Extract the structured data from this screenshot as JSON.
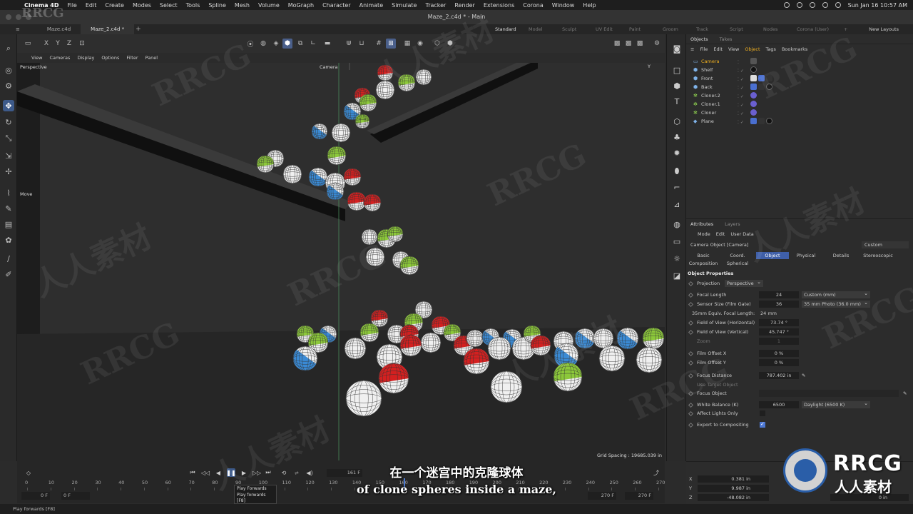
{
  "menubar": {
    "app_name": "Cinema 4D",
    "items": [
      "File",
      "Edit",
      "Create",
      "Modes",
      "Select",
      "Tools",
      "Spline",
      "Mesh",
      "Volume",
      "MoGraph",
      "Character",
      "Animate",
      "Simulate",
      "Tracker",
      "Render",
      "Extensions",
      "Corona",
      "Window",
      "Help"
    ],
    "clock": "Sun Jan 16  10:57 AM"
  },
  "window": {
    "title": "Maze_2.c4d * - Main"
  },
  "doc_tabs": [
    "Maze.c4d",
    "Maze_2.c4d *"
  ],
  "layout_tabs": [
    "Standard",
    "Model",
    "Sculpt",
    "UV Edit",
    "Paint",
    "Groom",
    "Track",
    "Script",
    "Nodes",
    "Corona (User)"
  ],
  "new_layouts": "New Layouts",
  "viewport": {
    "menu": [
      "View",
      "Cameras",
      "Display",
      "Options",
      "Filter",
      "Panel"
    ],
    "axis_buttons": [
      "X",
      "Y",
      "Z"
    ],
    "label_view": "Perspective",
    "label_camera": "Camera",
    "move_label": "Move",
    "grid_spacing": "Grid Spacing : 19685.039 in",
    "axis_y": "Y",
    "colors": {
      "red": "#d42020",
      "green": "#8cc83a",
      "blue": "#3a8ad4",
      "white": "#f0f0f0"
    }
  },
  "timeline": {
    "current_frame": "161 F",
    "ruler_ticks": [
      "0",
      "10",
      "20",
      "30",
      "40",
      "50",
      "60",
      "70",
      "80",
      "90",
      "100",
      "110",
      "120",
      "130",
      "140",
      "150",
      "160",
      "170",
      "180",
      "190",
      "200",
      "210",
      "220",
      "230",
      "240",
      "250",
      "260",
      "270"
    ],
    "start_a": "0 F",
    "start_b": "0 F",
    "end_a": "270 F",
    "end_b": "270 F"
  },
  "tooltip": {
    "title": "Play Forwards",
    "desc": "Play forwards",
    "shortcut": "[F8]"
  },
  "status": "Play forwards [F8]",
  "object_manager": {
    "tabs": [
      "Objects",
      "Takes"
    ],
    "menu": [
      "File",
      "Edit",
      "View",
      "Object",
      "Tags",
      "Bookmarks"
    ],
    "objects": [
      {
        "name": "Camera"
      },
      {
        "name": "Shelf"
      },
      {
        "name": "Front"
      },
      {
        "name": "Back"
      },
      {
        "name": "Cloner.2"
      },
      {
        "name": "Cloner.1"
      },
      {
        "name": "Cloner"
      },
      {
        "name": "Plane"
      }
    ]
  },
  "attributes": {
    "tabs": [
      "Attributes",
      "Layers"
    ],
    "menu": [
      "Mode",
      "Edit",
      "User Data"
    ],
    "object_label": "Camera Object [Camera]",
    "custom_dropdown": "Custom",
    "property_tabs": [
      "Basic",
      "Coord.",
      "Object",
      "Physical",
      "Details",
      "Stereoscopic",
      "Composition",
      "Spherical"
    ],
    "section": "Object Properties",
    "projection_label": "Projection",
    "projection_value": "Perspective",
    "focal_length": {
      "label": "Focal Length",
      "value": "24",
      "preset": "Custom (mm)"
    },
    "sensor_size": {
      "label": "Sensor Size (Film Gate)",
      "value": "36",
      "preset": "35 mm Photo (36.0 mm)"
    },
    "equiv_focal": {
      "label": "35mm Equiv. Focal Length:",
      "value": "24 mm"
    },
    "fov_h": {
      "label": "Field of View (Horizontal)",
      "value": "73.74 °"
    },
    "fov_v": {
      "label": "Field of View (Vertical)",
      "value": "45.747 °"
    },
    "zoom": {
      "label": "Zoom",
      "value": "1"
    },
    "film_offset_x": {
      "label": "Film Offset X",
      "value": "0 %"
    },
    "film_offset_y": {
      "label": "Film Offset Y",
      "value": "0 %"
    },
    "focus_distance": {
      "label": "Focus Distance",
      "value": "787.402 in"
    },
    "use_target": {
      "label": "Use Target Object"
    },
    "focus_object": {
      "label": "Focus Object"
    },
    "white_balance": {
      "label": "White Balance (K)",
      "value": "6500",
      "preset": "Daylight (6500 K)"
    },
    "affect_lights": {
      "label": "Affect Lights Only"
    },
    "export_comp": {
      "label": "Export to Compositing"
    }
  },
  "coordinates": {
    "x": {
      "axis": "X",
      "value": "0.381 in"
    },
    "y": {
      "axis": "Y",
      "value": "9.987 in"
    },
    "z": {
      "axis": "Z",
      "value": "-48.082 in",
      "value2": "0 in"
    }
  },
  "subtitles": {
    "chinese": "在一个迷宫中的克隆球体",
    "english": "of clone spheres inside a maze,"
  },
  "watermark": {
    "latin": "RRCG",
    "cjk": "人人素材"
  }
}
